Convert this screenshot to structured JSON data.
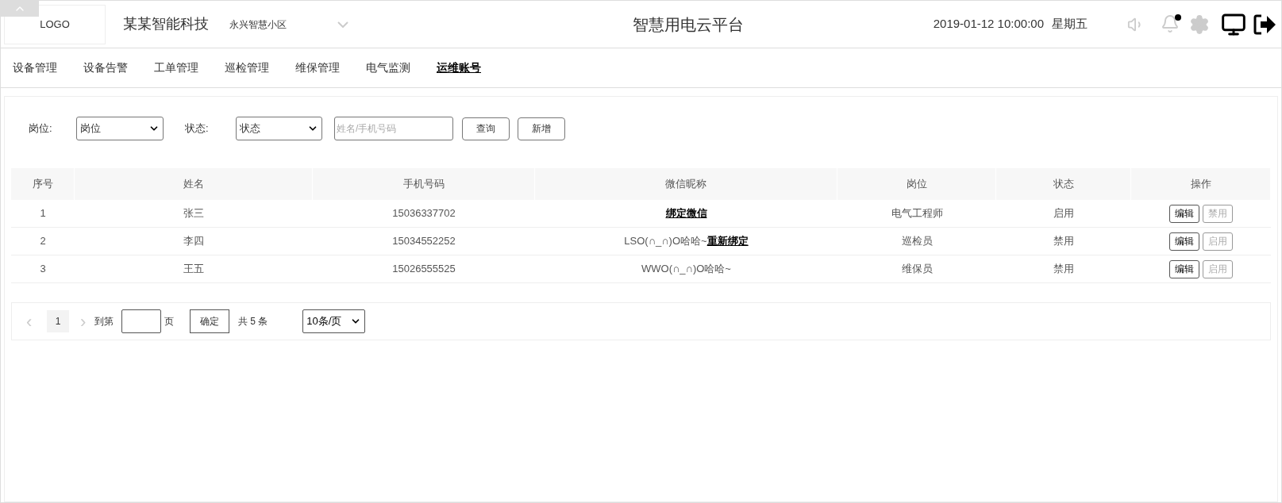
{
  "header": {
    "logo": "LOGO",
    "company": "某某智能科技",
    "community": "永兴智慧小区",
    "title": "智慧用电云平台",
    "datetime": "2019-01-12 10:00:00",
    "weekday": "星期五",
    "bell_unread": true
  },
  "nav": [
    {
      "label": "设备管理",
      "selected": false
    },
    {
      "label": "设备告警",
      "selected": false
    },
    {
      "label": "工单管理",
      "selected": false
    },
    {
      "label": "巡检管理",
      "selected": false
    },
    {
      "label": "维保管理",
      "selected": false
    },
    {
      "label": "电气监测",
      "selected": false
    },
    {
      "label": "运维账号",
      "selected": true
    }
  ],
  "filters": {
    "position_label": "岗位:",
    "position_value": "岗位",
    "status_label": "状态:",
    "status_value": "状态",
    "search_placeholder": "姓名/手机号码",
    "query_button": "查询",
    "add_button": "新增"
  },
  "table": {
    "columns": [
      "序号",
      "姓名",
      "手机号码",
      "微信昵称",
      "岗位",
      "状态",
      "操作"
    ],
    "rows": [
      {
        "index": "1",
        "name": "张三",
        "phone": "15036337702",
        "wechat": {
          "link": "绑定微信"
        },
        "position": "电气工程师",
        "status": "启用",
        "actions": [
          "编辑",
          "禁用"
        ]
      },
      {
        "index": "2",
        "name": "李四",
        "phone": "15034552252",
        "wechat": {
          "text": "LSO(∩_∩)O哈哈~",
          "link": "重新绑定"
        },
        "position": "巡检员",
        "status": "禁用",
        "actions": [
          "编辑",
          "启用"
        ]
      },
      {
        "index": "3",
        "name": "王五",
        "phone": "15026555525",
        "wechat": {
          "text": "WWO(∩_∩)O哈哈~"
        },
        "position": "维保员",
        "status": "禁用",
        "actions": [
          "编辑",
          "启用"
        ]
      }
    ]
  },
  "pagination": {
    "prev": "‹",
    "pages": [
      {
        "label": "1",
        "selected": true
      }
    ],
    "next": "›",
    "goto_label": "到第",
    "page_unit": "页",
    "confirm": "确定",
    "total": "共 5 条",
    "page_size": "10条/页"
  }
}
